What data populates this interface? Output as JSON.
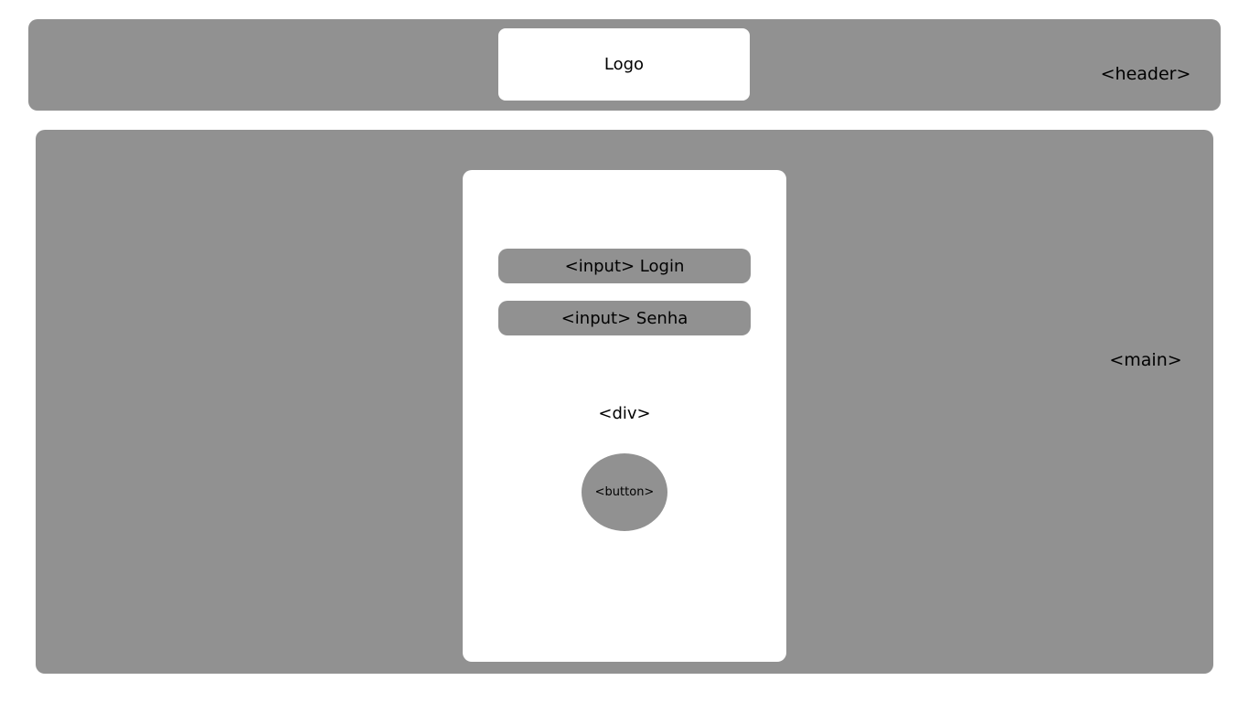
{
  "header": {
    "logo_label": "Logo",
    "tag": "<header>"
  },
  "main": {
    "tag": "<main>",
    "card": {
      "login_input_label": "<input> Login",
      "password_input_label": "<input> Senha",
      "div_tag": "<div>",
      "button_label": "<button>"
    }
  },
  "colors": {
    "container": "#919191",
    "panel": "#ffffff",
    "text": "#000000"
  }
}
